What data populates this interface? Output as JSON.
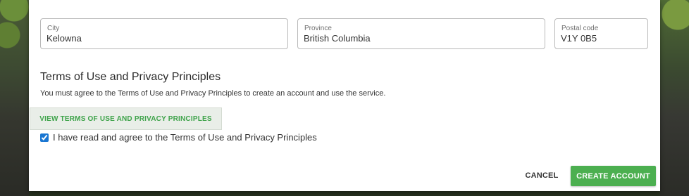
{
  "address": {
    "city": {
      "label": "City",
      "value": "Kelowna"
    },
    "province": {
      "label": "Province",
      "value": "British Columbia"
    },
    "postal_code": {
      "label": "Postal code",
      "value": "V1Y 0B5"
    }
  },
  "terms": {
    "title": "Terms of Use and Privacy Principles",
    "description": "You must agree to the Terms of Use and Privacy Principles to create an account and use the service.",
    "view_button": "VIEW TERMS OF USE AND PRIVACY PRINCIPLES",
    "agree_label": "I have read and agree to the Terms of Use and Privacy Principles",
    "agree_checked": true
  },
  "actions": {
    "cancel": "CANCEL",
    "create": "CREATE ACCOUNT"
  },
  "colors": {
    "primary": "#4caf50",
    "checkbox": "#1976d2"
  }
}
